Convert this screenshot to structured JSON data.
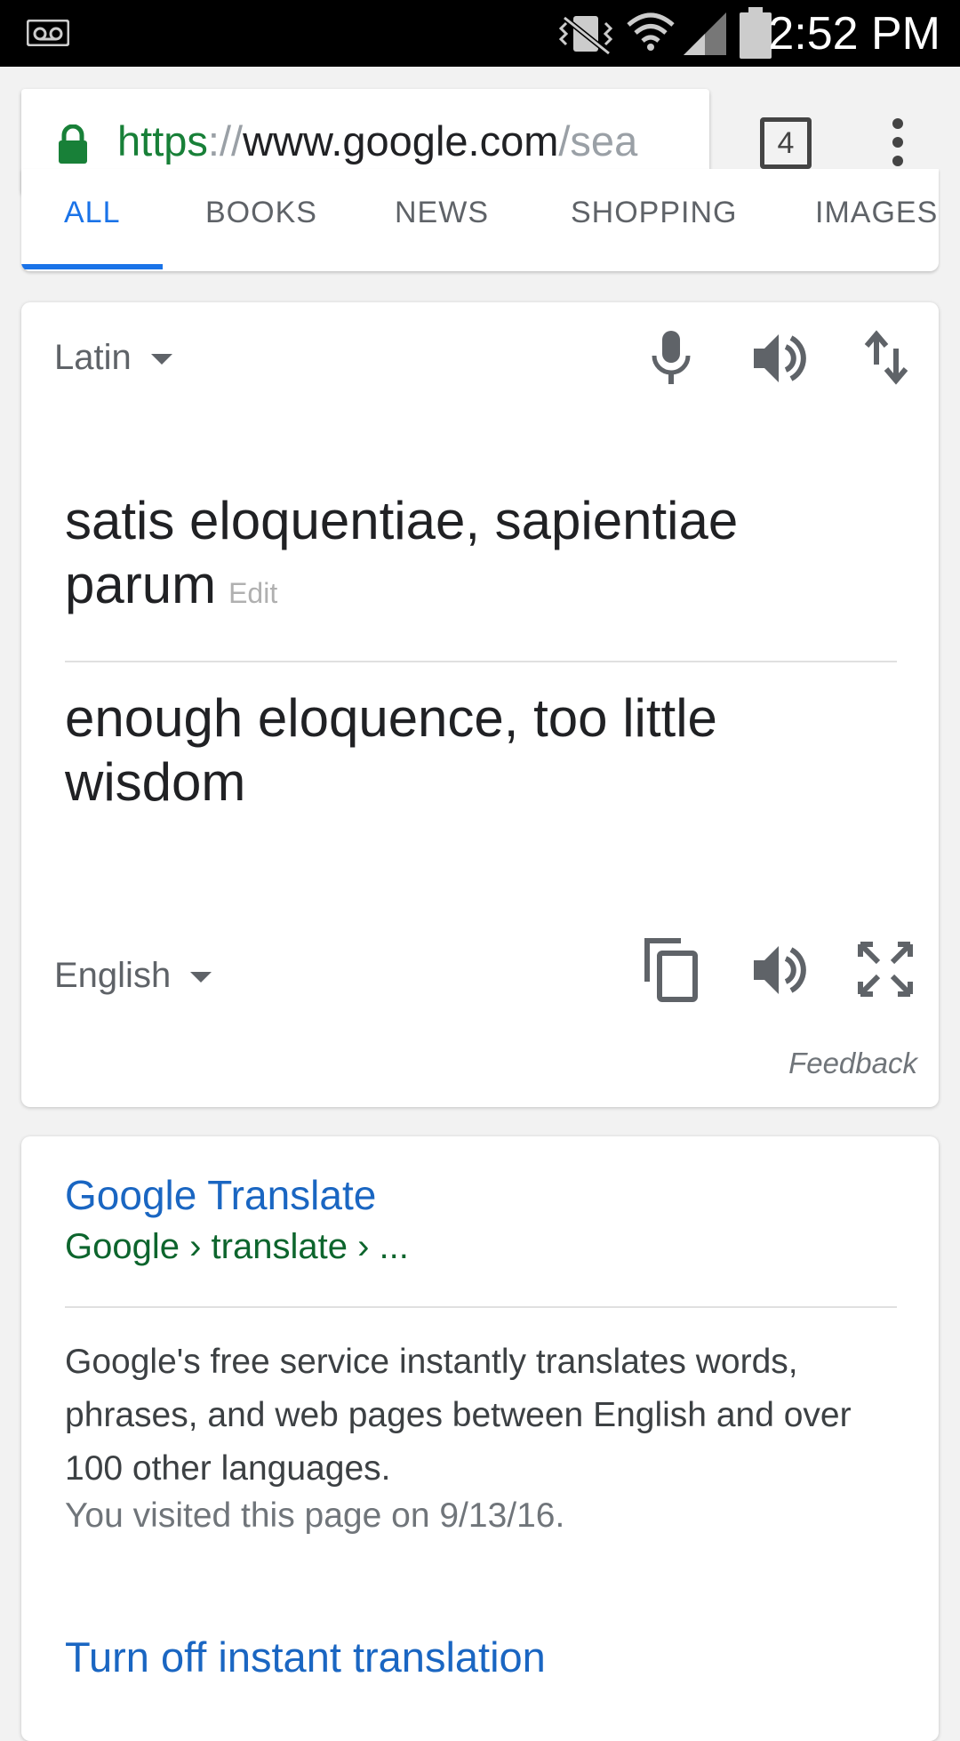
{
  "status_bar": {
    "time": "2:52 PM",
    "icons": [
      "voicemail-icon",
      "vibrate-icon",
      "wifi-icon",
      "signal-icon",
      "battery-icon"
    ]
  },
  "browser": {
    "url_scheme": "https",
    "url_sep": "://",
    "url_host": "www.google.com",
    "url_path": "/sea",
    "tab_count": "4"
  },
  "search_tabs": [
    "ALL",
    "BOOKS",
    "NEWS",
    "SHOPPING",
    "IMAGES"
  ],
  "translate": {
    "source_language": "Latin",
    "source_text": "satis eloquentiae, sapientiae parum",
    "edit_label": "Edit",
    "target_text": "enough eloquence, too little wisdom",
    "target_language": "English",
    "feedback_label": "Feedback"
  },
  "result": {
    "title": "Google Translate",
    "breadcrumb": "Google › translate › ...",
    "snippet": "Google's free service instantly translates words, phrases, and web pages between English and over 100 other languages.",
    "visited": "You visited this page on 9/13/16.",
    "toggle_link": "Turn off instant translation"
  },
  "colors": {
    "link_blue": "#1a66c2",
    "url_green": "#0d652d",
    "accent_blue": "#1a73e8",
    "lock_green": "#188038"
  }
}
